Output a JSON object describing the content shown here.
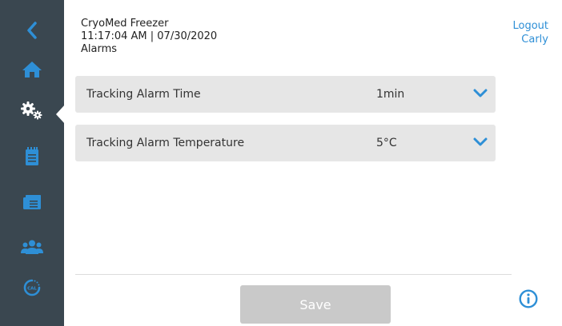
{
  "header": {
    "device_name": "CryoMed Freezer",
    "datetime": "11:17:04 AM | 07/30/2020",
    "page_title": "Alarms"
  },
  "user": {
    "logout_label": "Logout",
    "username": "Carly"
  },
  "settings": [
    {
      "label": "Tracking Alarm Time",
      "value": "1min"
    },
    {
      "label": "Tracking Alarm Temperature",
      "value": "5°C"
    }
  ],
  "footer": {
    "save_label": "Save"
  },
  "sidebar": {
    "items": [
      "back-icon",
      "home-icon",
      "settings-gears-icon",
      "notebook-icon",
      "records-icon",
      "users-icon",
      "calibration-icon"
    ],
    "active": "settings-gears-icon"
  },
  "colors": {
    "sidebar_bg": "#3a4750",
    "accent_blue": "#2e8fd6",
    "row_bg": "#e6e6e6",
    "save_disabled": "#c9c9c9"
  }
}
